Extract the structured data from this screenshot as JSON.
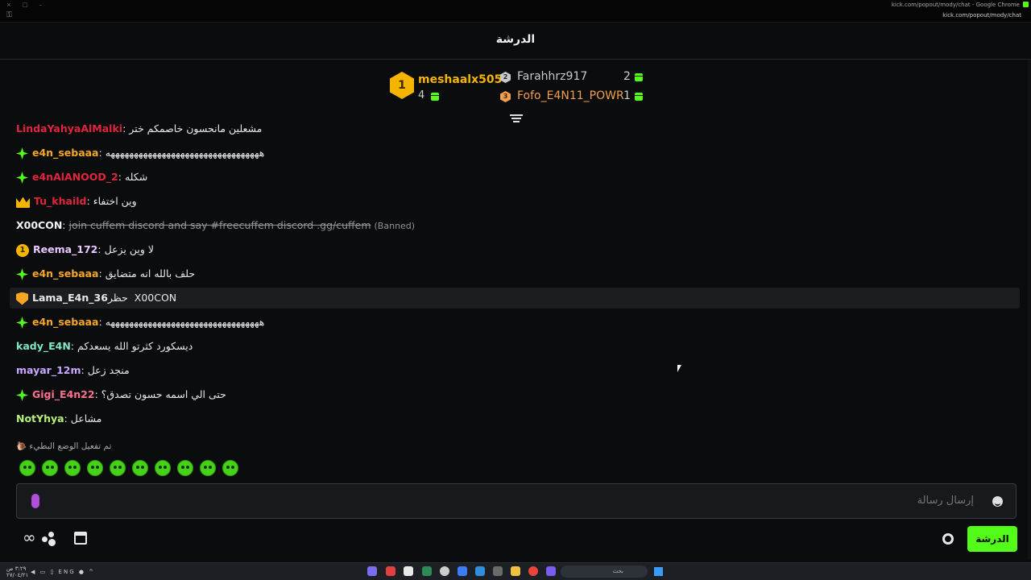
{
  "browser": {
    "window_title": "kick.com/popout/mody/chat - Google Chrome",
    "url": "kick.com/popout/mody/chat"
  },
  "header": {
    "title": "الدرشة"
  },
  "leaderboard": {
    "first": {
      "rank": "1",
      "name": "meshaalx505",
      "count": "4",
      "color": "#f5b400"
    },
    "second": {
      "rank": "2",
      "name": "Farahhrz917",
      "count": "2",
      "color": "#c9c9c9"
    },
    "third": {
      "rank": "3",
      "name": "Fofo_E4N11_POWR",
      "count": "1",
      "color": "#f0a04b"
    }
  },
  "messages": [
    {
      "badge": "none",
      "user": "LindaYahyaAlMalki",
      "sep": ":",
      "text": "مشعلين مانحسون خاصمكم ختر",
      "user_color": "#e0243c",
      "highlight": false,
      "banned": false
    },
    {
      "badge": "star",
      "user": "e4n_sebaaa",
      "sep": ":",
      "text": "هههههههههههههههههههههههههههههههههه",
      "user_color": "#f5a623",
      "highlight": false,
      "banned": false
    },
    {
      "badge": "star",
      "user": "e4nAlANOOD_2",
      "sep": ":",
      "text": "شكله",
      "user_color": "#e0243c",
      "highlight": false,
      "banned": false
    },
    {
      "badge": "crown",
      "user": "Tu_khaild",
      "sep": ":",
      "text": "وين اختفاء",
      "user_color": "#e0243c",
      "highlight": false,
      "banned": false
    },
    {
      "badge": "none",
      "user": "X00CON",
      "sep": ":",
      "text": "join cuffem discord and say #freecuffem discord .gg/cuffem",
      "user_color": "#f2f2f2",
      "highlight": false,
      "banned": true,
      "ban_note": "(Banned)"
    },
    {
      "badge": "gold1",
      "user": "Reema_172",
      "sep": ":",
      "text": "لا وين يزعل",
      "user_color": "#e8c8ff",
      "highlight": false,
      "banned": false
    },
    {
      "badge": "star",
      "user": "e4n_sebaaa",
      "sep": ":",
      "text": "حلف بالله انه متضايق",
      "user_color": "#f5a623",
      "highlight": false,
      "banned": false
    },
    {
      "badge": "shield",
      "user": "Lama_E4n_36",
      "sep": "",
      "text": "حظر X00CON",
      "user_color": "#e8e8e8",
      "highlight": true,
      "banned": false
    },
    {
      "badge": "star",
      "user": "e4n_sebaaa",
      "sep": ":",
      "text": "هههههههههههههههههههههههههههههههههه",
      "user_color": "#f5a623",
      "highlight": false,
      "banned": false
    },
    {
      "badge": "none",
      "user": "kady_E4N",
      "sep": ":",
      "text": "ديسكورد كثرتو الله يسعدكم",
      "user_color": "#7ee8c2",
      "highlight": false,
      "banned": false
    },
    {
      "badge": "none",
      "user": "mayar_12m",
      "sep": ":",
      "text": "منجد زعل",
      "user_color": "#c9a8ff",
      "highlight": false,
      "banned": false
    },
    {
      "badge": "star",
      "user": "Gigi_E4n22",
      "sep": ":",
      "text": "حتى الي اسمه حسون تصدق؟",
      "user_color": "#ff6f91",
      "highlight": false,
      "banned": false
    },
    {
      "badge": "none",
      "user": "NotYhya",
      "sep": ":",
      "text": "مشاعل",
      "user_color": "#b6f07a",
      "highlight": false,
      "banned": false
    }
  ],
  "slow_mode": "تم تفعيل الوضع البطيء",
  "emotes": [
    "happy-emote",
    "love-emote",
    "grin-emote",
    "smirk-emote",
    "angel-emote",
    "angry-emote",
    "shock-emote",
    "headphones-emote",
    "laugh-emote",
    "sweat-emote"
  ],
  "input": {
    "placeholder": "إرسال رسالة"
  },
  "bottom": {
    "chat_button": "الدرشة"
  },
  "taskbar": {
    "time": "٣:٢٩ ص",
    "date": "٢٧/٠٤/٢١",
    "lang": "ENG",
    "search_label": "بحث"
  },
  "colors": {
    "accent": "#53fc18",
    "background": "#0b0c0e"
  }
}
